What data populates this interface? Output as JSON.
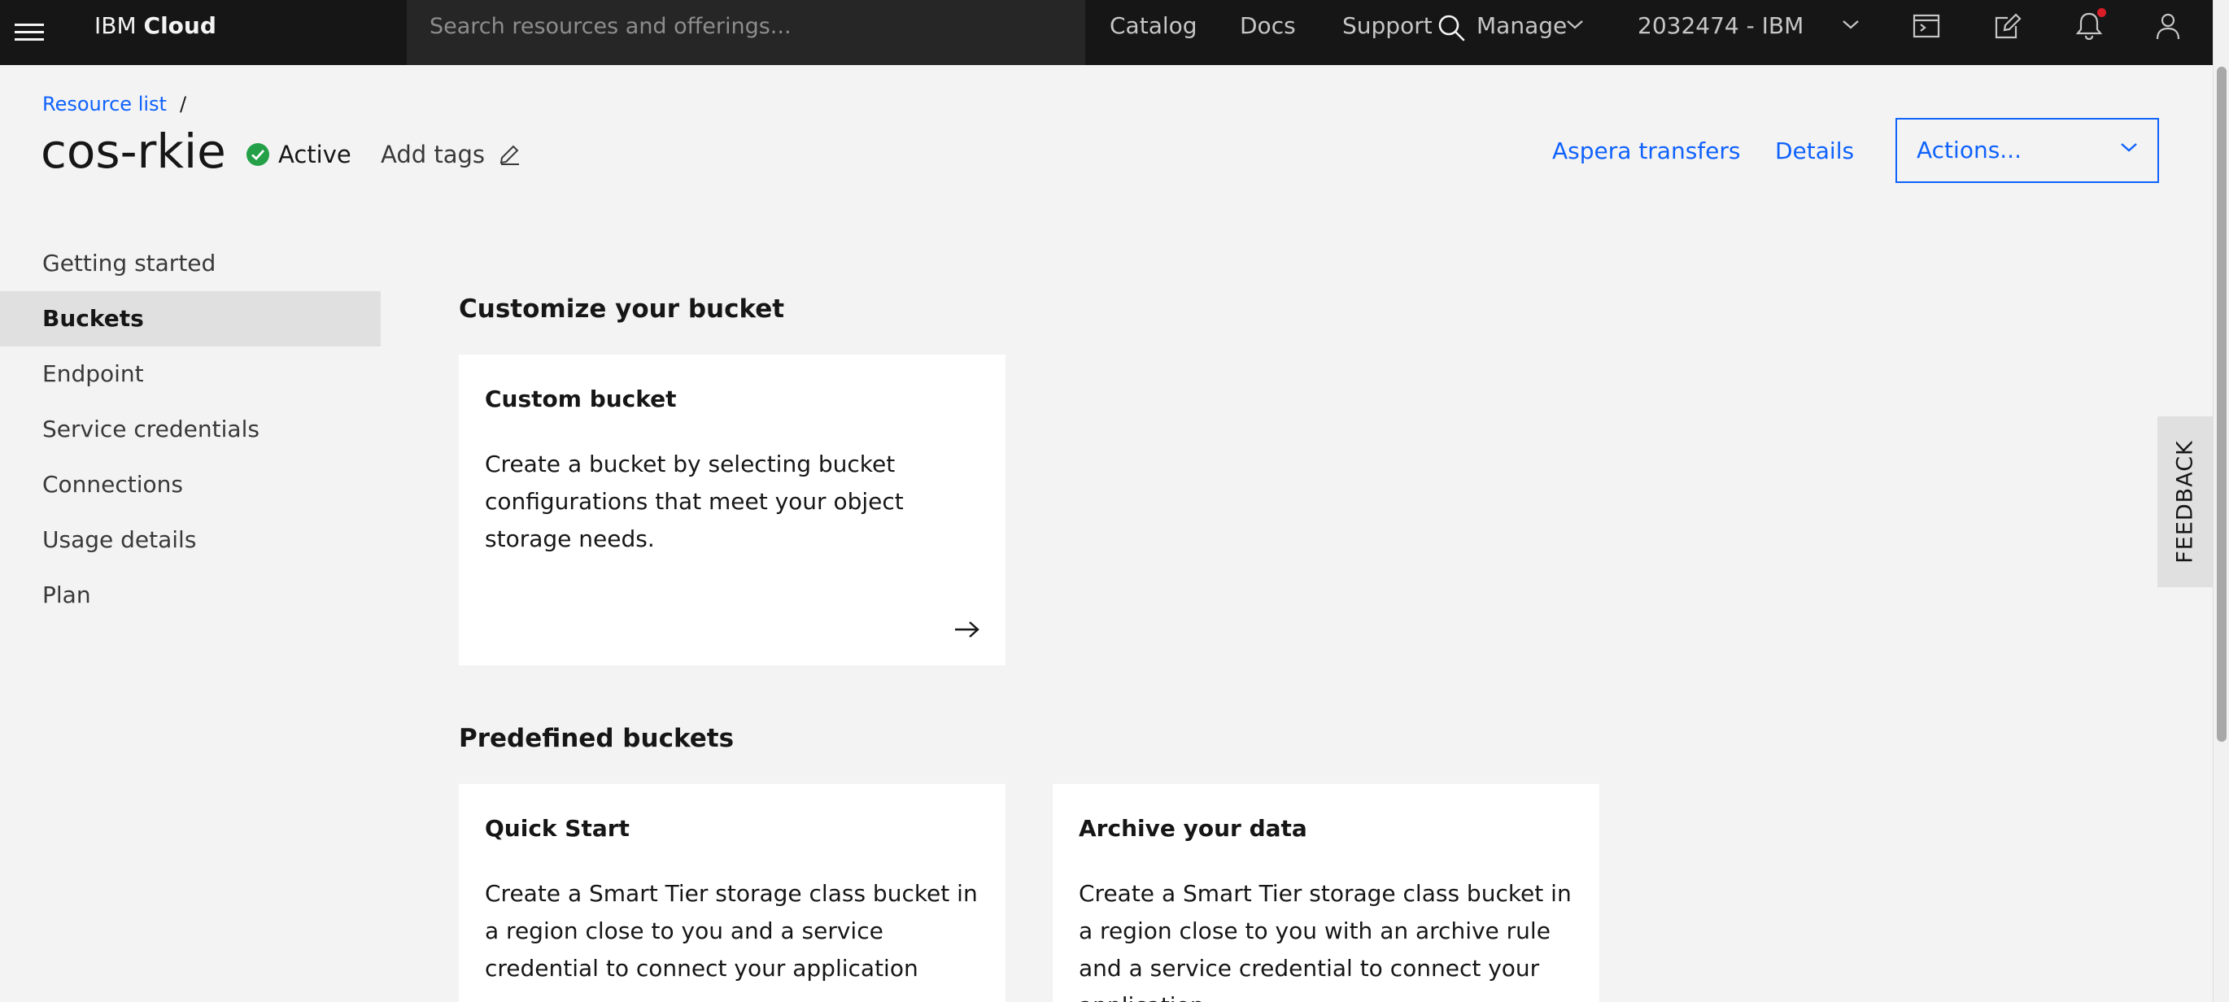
{
  "header": {
    "brand_prefix": "IBM",
    "brand_bold": "Cloud",
    "search_placeholder": "Search resources and offerings...",
    "nav": {
      "catalog": "Catalog",
      "docs": "Docs",
      "support": "Support",
      "manage": "Manage",
      "account": "2032474 - IBM"
    },
    "icons": [
      "menu-icon",
      "search-icon",
      "chevron-down-icon",
      "terminal-icon",
      "edit-icon",
      "notification-icon",
      "user-icon"
    ],
    "notification_dot_color": "#da1e28"
  },
  "page": {
    "breadcrumb_link": "Resource list",
    "breadcrumb_separator": "/",
    "title": "cos-rkie",
    "status": "Active",
    "status_color": "#24a148",
    "add_tags": "Add tags",
    "aspera": "Aspera transfers",
    "details": "Details",
    "actions": "Actions..."
  },
  "sidebar": {
    "items": [
      {
        "label": "Getting started"
      },
      {
        "label": "Buckets"
      },
      {
        "label": "Endpoint"
      },
      {
        "label": "Service credentials"
      },
      {
        "label": "Connections"
      },
      {
        "label": "Usage details"
      },
      {
        "label": "Plan"
      }
    ],
    "active": "Buckets"
  },
  "main": {
    "customize_title": "Customize your bucket",
    "custom_bucket": {
      "title": "Custom bucket",
      "desc": "Create a bucket by selecting bucket configurations that meet your object storage needs."
    },
    "predefined_title": "Predefined buckets",
    "quick_start": {
      "title": "Quick Start",
      "desc": "Create a Smart Tier storage class bucket in a region close to you and a service credential to connect your application"
    },
    "archive": {
      "title": "Archive your data",
      "desc": "Create a Smart Tier storage class bucket in a region close to you with an archive rule and a service credential to connect your application"
    }
  },
  "feedback": "FEEDBACK",
  "colors": {
    "header_bg": "#161616",
    "search_bg": "#262626",
    "link": "#0f62fe",
    "page_bg": "#f3f3f3",
    "active_nav_bg": "#e0e0e0"
  }
}
